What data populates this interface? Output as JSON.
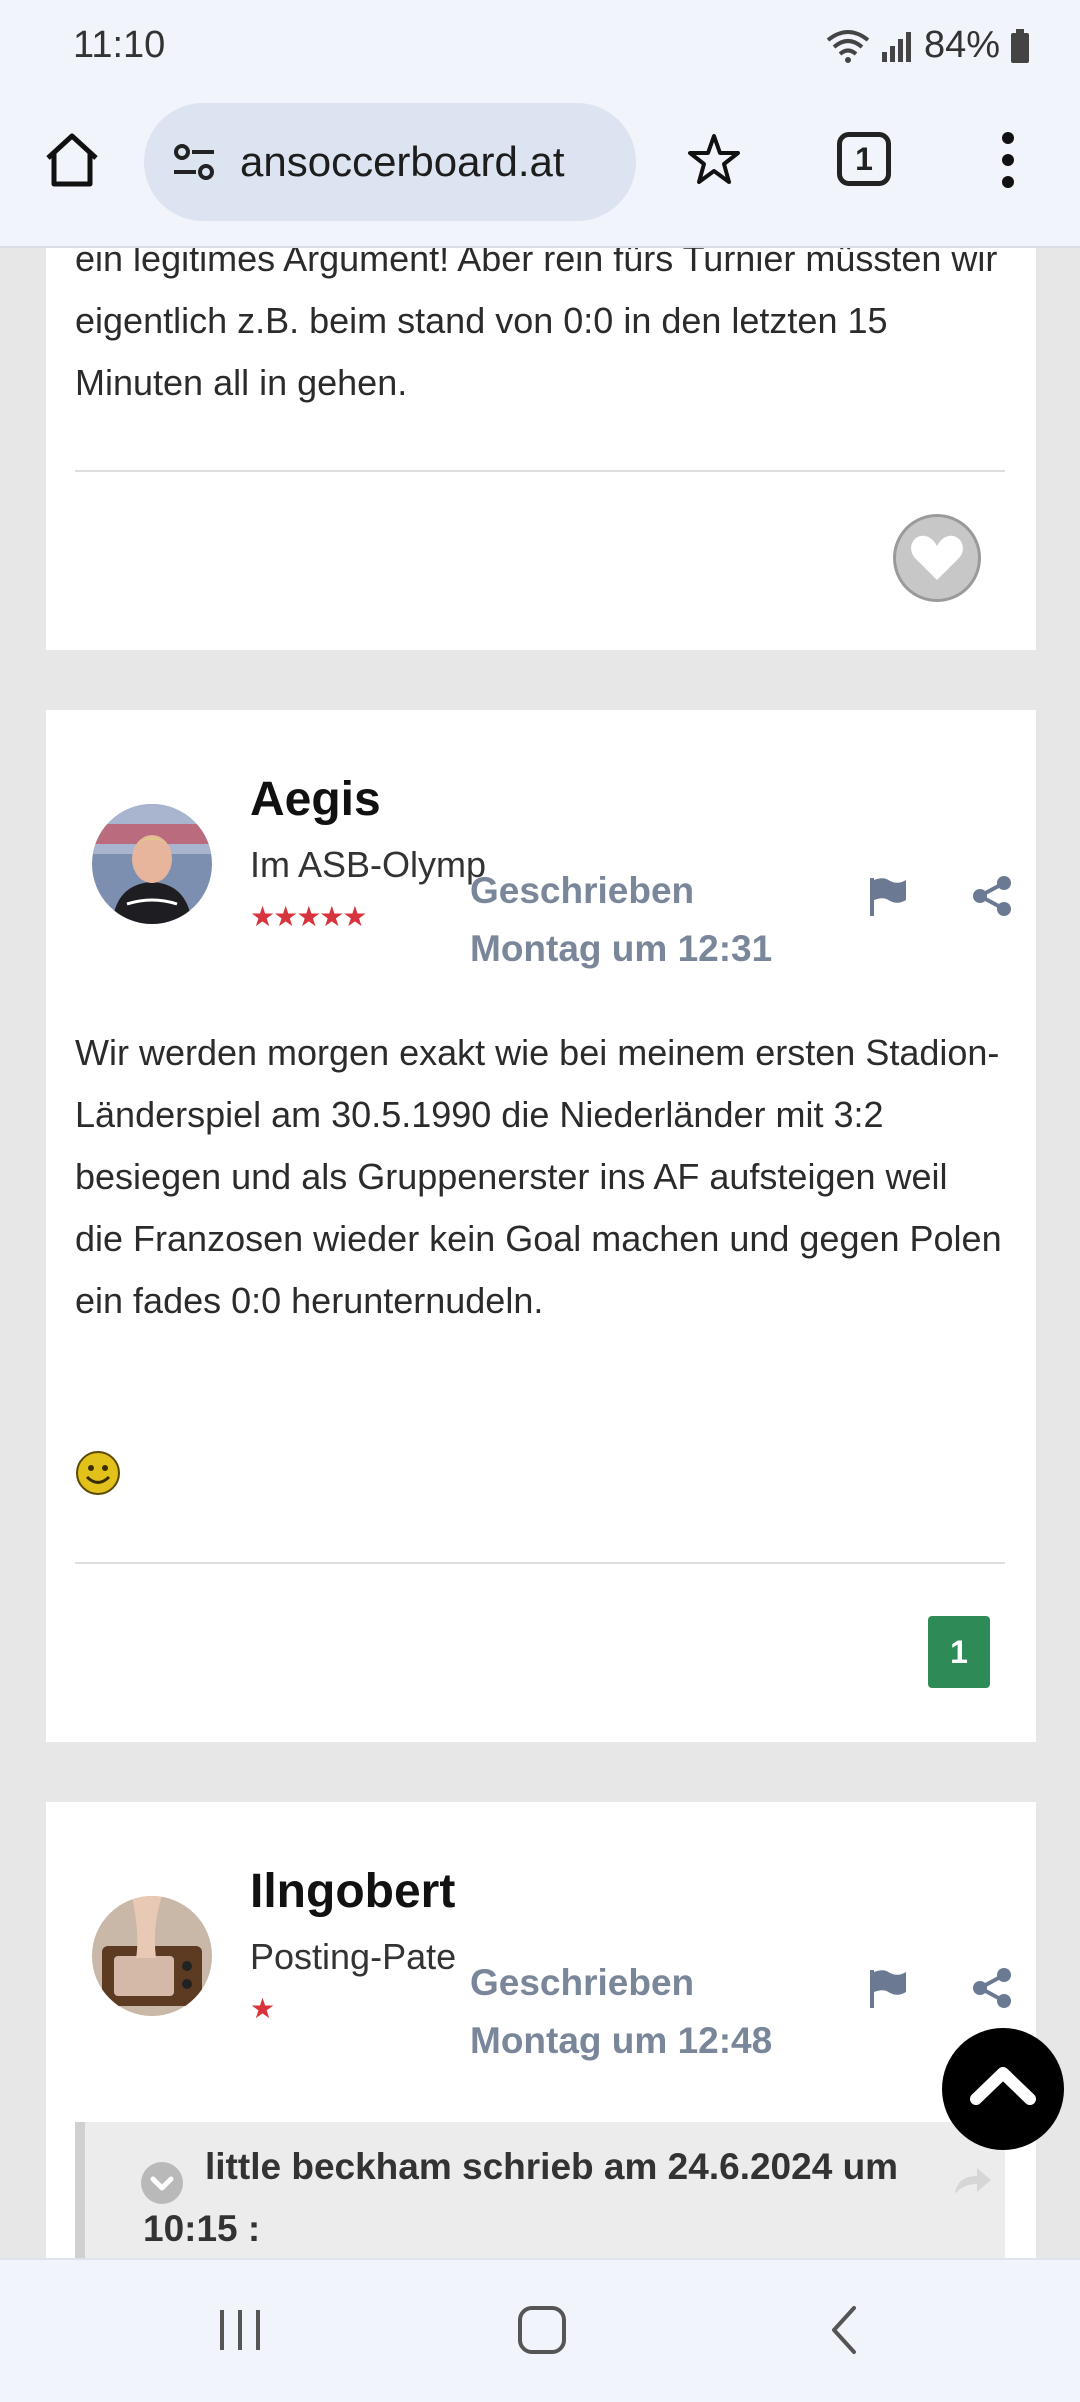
{
  "status_bar": {
    "time": "11:10",
    "battery": "84%"
  },
  "browser": {
    "url": "ansoccerboard.at",
    "tab_count": "1"
  },
  "post_prev": {
    "text_partial": "ein legitimes Argument! Aber rein fürs Turnier müssten wir eigentlich z.B. beim stand von 0:0 in den letzten 15 Minuten all in gehen."
  },
  "post_aegis": {
    "author": "Aegis",
    "rank": "Im ASB-Olymp",
    "stars": "★★★★★",
    "written_label": "Geschrieben",
    "written_time": "Montag um 12:31",
    "text": "Wir werden morgen exakt wie bei meinem ersten Stadion-Länderspiel am 30.5.1990 die Niederländer mit 3:2 besiegen und als Gruppenerster ins AF aufsteigen weil die Franzosen wieder kein Goal machen und gegen Polen ein fades 0:0 herunternudeln.",
    "reaction_count": "1"
  },
  "post_ilngobert": {
    "author": "Ilngobert",
    "rank": "Posting-Pate",
    "stars": "★",
    "written_label": "Geschrieben",
    "written_time": "Montag um 12:48",
    "quote_header": "little beckham schrieb am 24.6.2024 um 10:15 :"
  },
  "colors": {
    "accent_green": "#2e8b57",
    "meta_gray": "#7a8699",
    "star_red": "#d8343e"
  }
}
